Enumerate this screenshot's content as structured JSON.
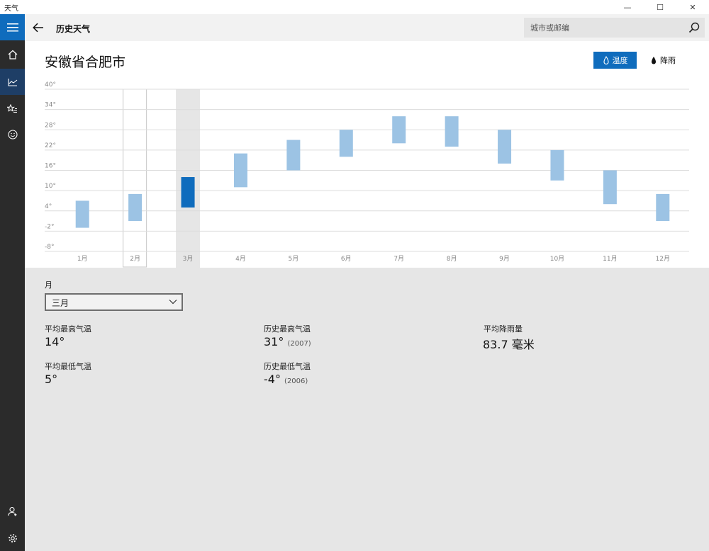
{
  "window": {
    "title": "天气",
    "minimize": "—",
    "maximize": "☐",
    "close": "✕"
  },
  "header": {
    "title": "历史天气",
    "search_placeholder": "城市或邮编"
  },
  "city": "安徽省合肥市",
  "toggles": {
    "temperature": "温度",
    "rain": "降雨"
  },
  "colors": {
    "accent": "#0f6cbd",
    "bar": "#9cc3e4",
    "bar_selected": "#0f6cbd",
    "sidebar": "#2b2b2b"
  },
  "chart_data": {
    "type": "bar",
    "subtype": "range",
    "y_ticks": [
      "40°",
      "34°",
      "28°",
      "22°",
      "16°",
      "10°",
      "4°",
      "-2°",
      "-8°"
    ],
    "ylim": [
      -8,
      40
    ],
    "grid": true,
    "categories": [
      "1月",
      "2月",
      "3月",
      "4月",
      "5月",
      "6月",
      "7月",
      "8月",
      "9月",
      "10月",
      "11月",
      "12月"
    ],
    "series": [
      {
        "low": [
          -1,
          1,
          5,
          11,
          16,
          20,
          24,
          23,
          18,
          13,
          6,
          1
        ]
      },
      {
        "high": [
          7,
          9,
          14,
          21,
          25,
          28,
          32,
          32,
          28,
          22,
          16,
          9
        ]
      }
    ],
    "selected_index": 2,
    "hover_index": 1
  },
  "detail": {
    "month_label": "月",
    "month_value": "三月",
    "avg_high_label": "平均最高气温",
    "avg_high_value": "14°",
    "avg_low_label": "平均最低气温",
    "avg_low_value": "5°",
    "record_high_label": "历史最高气温",
    "record_high_value": "31°",
    "record_high_year": "(2007)",
    "record_low_label": "历史最低气温",
    "record_low_value": "-4°",
    "record_low_year": "(2006)",
    "avg_rain_label": "平均降雨量",
    "avg_rain_value": "83.7 毫米"
  }
}
